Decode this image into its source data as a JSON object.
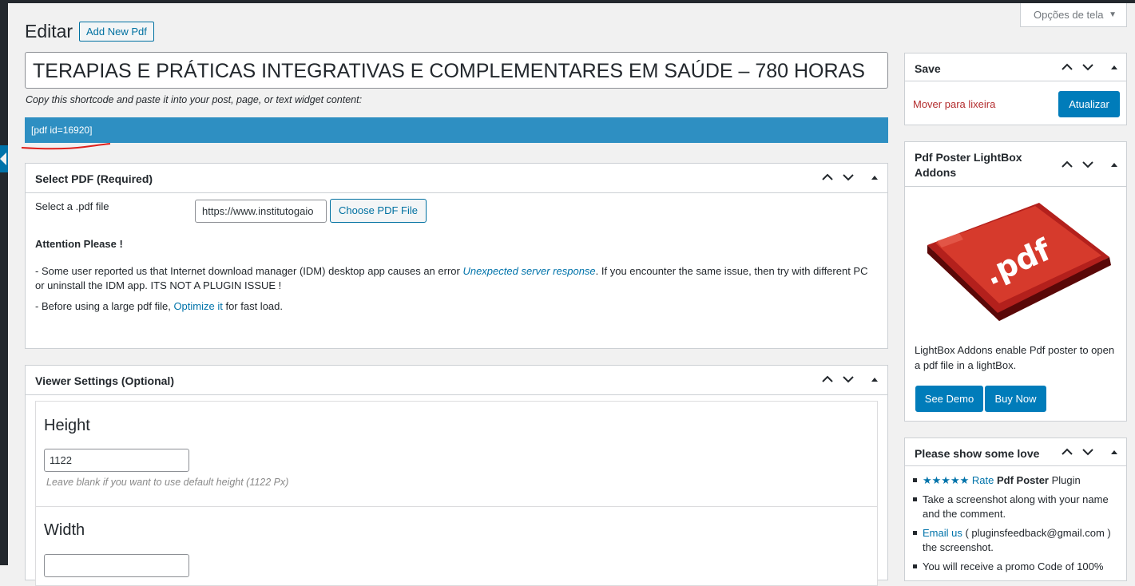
{
  "header": {
    "screen_options_label": "Opções de tela",
    "page_title": "Editar",
    "add_new_label": "Add New Pdf"
  },
  "editor": {
    "post_title": "TERAPIAS E PRÁTICAS INTEGRATIVAS E COMPLEMENTARES EM SAÚDE – 780 HORAS",
    "shortcode_help": "Copy this shortcode and paste it into your post, page, or text widget content:",
    "shortcode": "[pdf id=16920]"
  },
  "select_pdf": {
    "title": "Select PDF (Required)",
    "file_label": "Select a .pdf file",
    "file_value": "https://www.institutogaio",
    "choose_button": "Choose PDF File",
    "attention_heading": "Attention Please !",
    "note1_before": "- Some user reported us that Internet download manager (IDM) desktop app causes an error ",
    "note1_link": "Unexpected server response",
    "note1_after": ". If you encounter the same issue, then try with different PC or uninstall the IDM app. ITS NOT A PLUGIN ISSUE !",
    "note2_before": "- Before using a large pdf file, ",
    "note2_link": "Optimize it",
    "note2_after": " for fast load."
  },
  "viewer_settings": {
    "title": "Viewer Settings (Optional)",
    "height_label": "Height",
    "height_value": "1122",
    "height_hint": "Leave blank if you want to use default height (1122 Px)",
    "width_label": "Width",
    "width_value": ""
  },
  "save_box": {
    "title": "Save",
    "trash_link": "Mover para lixeira",
    "update_button": "Atualizar"
  },
  "lightbox_box": {
    "title": "Pdf Poster LightBox Addons",
    "image_text": ".pdf",
    "description": "LightBox Addons enable Pdf poster to open a pdf file in a lightBox.",
    "see_demo": "See Demo",
    "buy_now": "Buy Now"
  },
  "love_box": {
    "title": "Please show some love",
    "item1_stars": "★★★★★ Rate",
    "item1_bold": "Pdf Poster",
    "item1_rest": " Plugin",
    "item2": "Take a screenshot along with your name and the comment.",
    "item3_link": "Email us",
    "item3_rest": " ( pluginsfeedback@gmail.com ) the screenshot.",
    "item4": "You will receive a promo Code of 100%"
  },
  "colors": {
    "admin_bar": "#23282d",
    "primary": "#007cba",
    "link": "#0073aa",
    "shortcode_bar": "#2e8fc2",
    "trash": "#b32d2e",
    "annotation": "#e0201b"
  },
  "icons": [
    "chevron-up-icon",
    "chevron-down-icon",
    "triangle-up-icon",
    "caret-down-icon"
  ]
}
